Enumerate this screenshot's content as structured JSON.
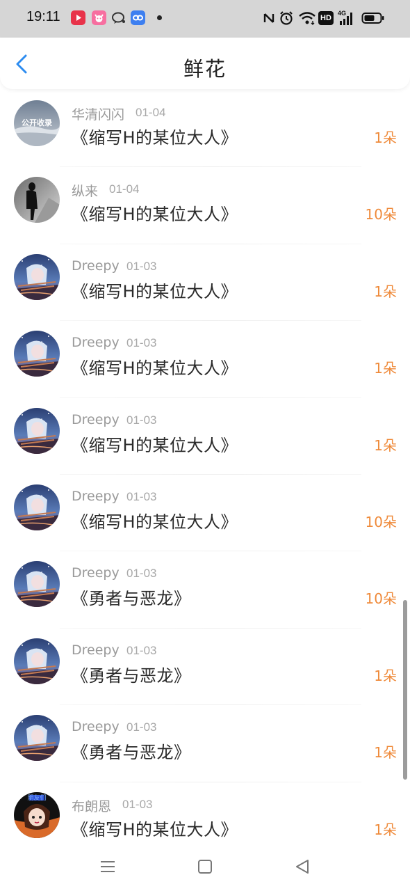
{
  "status_bar": {
    "time": "19:11",
    "icons_left": [
      "video-app-icon",
      "pink-app-icon",
      "chat-bubble-icon",
      "link-app-icon",
      "dot-icon"
    ],
    "icons_right": [
      "nfc-icon",
      "alarm-icon",
      "wifi-icon",
      "hd-icon",
      "4g-signal-icon",
      "battery-icon"
    ],
    "signal_label": "4G",
    "hd_label": "HD"
  },
  "header": {
    "title": "鲜花",
    "back_icon": "chevron-left-icon",
    "accent_color": "#2d8cf0"
  },
  "colors": {
    "count": "#ef8a3a",
    "name": "#9a9a9a"
  },
  "items": [
    {
      "name": "华清闪闪",
      "date": "01-04",
      "work": "《缩写H的某位大人》",
      "count": "1朵",
      "avatar": "landscape-avatar",
      "avatar_text": "公开收录"
    },
    {
      "name": "纵来",
      "date": "01-04",
      "work": "《缩写H的某位大人》",
      "count": "10朵",
      "avatar": "silhouette-avatar"
    },
    {
      "name": "Dreepy",
      "date": "01-03",
      "work": "《缩写H的某位大人》",
      "count": "1朵",
      "avatar": "anime-night-avatar"
    },
    {
      "name": "Dreepy",
      "date": "01-03",
      "work": "《缩写H的某位大人》",
      "count": "1朵",
      "avatar": "anime-night-avatar"
    },
    {
      "name": "Dreepy",
      "date": "01-03",
      "work": "《缩写H的某位大人》",
      "count": "1朵",
      "avatar": "anime-night-avatar"
    },
    {
      "name": "Dreepy",
      "date": "01-03",
      "work": "《缩写H的某位大人》",
      "count": "10朵",
      "avatar": "anime-night-avatar"
    },
    {
      "name": "Dreepy",
      "date": "01-03",
      "work": "《勇者与恶龙》",
      "count": "10朵",
      "avatar": "anime-night-avatar"
    },
    {
      "name": "Dreepy",
      "date": "01-03",
      "work": "《勇者与恶龙》",
      "count": "1朵",
      "avatar": "anime-night-avatar"
    },
    {
      "name": "Dreepy",
      "date": "01-03",
      "work": "《勇者与恶龙》",
      "count": "1朵",
      "avatar": "anime-night-avatar"
    },
    {
      "name": "布朗恩",
      "date": "01-03",
      "work": "《缩写H的某位大人》",
      "count": "1朵",
      "avatar": "anime-girl-avatar",
      "avatar_text": "朋友们"
    }
  ],
  "nav_bar": {
    "icons": [
      "menu-icon",
      "home-square-icon",
      "back-triangle-icon"
    ]
  }
}
